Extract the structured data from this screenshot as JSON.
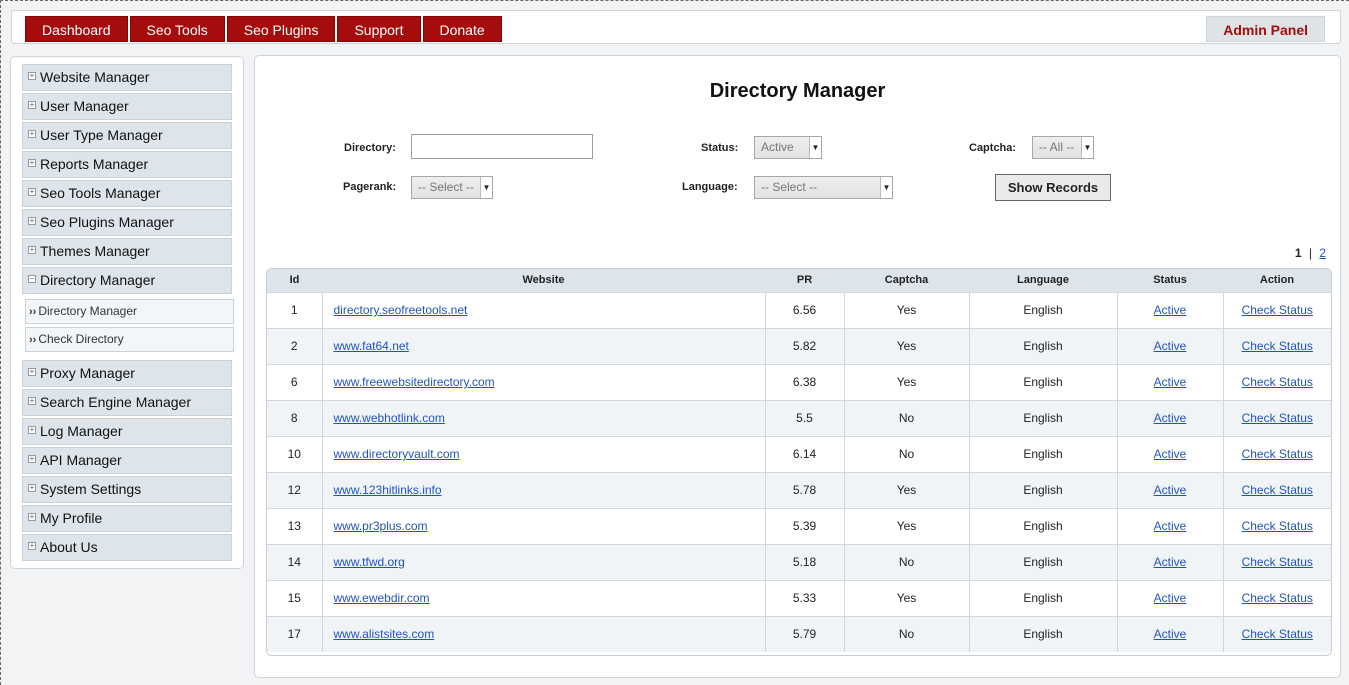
{
  "topnav": [
    "Dashboard",
    "Seo Tools",
    "Seo Plugins",
    "Support",
    "Donate"
  ],
  "admin_label": "Admin Panel",
  "sidebar": {
    "items_top": [
      "Website Manager",
      "User Manager",
      "User Type Manager",
      "Reports Manager",
      "Seo Tools Manager",
      "Seo Plugins Manager",
      "Themes Manager",
      "Directory Manager"
    ],
    "sub_items": [
      "Directory Manager",
      "Check Directory"
    ],
    "items_bottom": [
      "Proxy Manager",
      "Search Engine Manager",
      "Log Manager",
      "API Manager",
      "System Settings",
      "My Profile",
      "About Us"
    ]
  },
  "main": {
    "title": "Directory Manager",
    "filters": {
      "directory_label": "Directory:",
      "directory_value": "",
      "status_label": "Status:",
      "status_value": "Active",
      "captcha_label": "Captcha:",
      "captcha_value": "-- All --",
      "pagerank_label": "Pagerank:",
      "pagerank_value": "-- Select --",
      "language_label": "Language:",
      "language_value": "-- Select --",
      "show_button": "Show Records"
    },
    "pager": {
      "current": "1",
      "sep": "|",
      "next": "2"
    },
    "table": {
      "headers": [
        "Id",
        "Website",
        "PR",
        "Captcha",
        "Language",
        "Status",
        "Action"
      ],
      "rows": [
        {
          "id": "1",
          "website": "directory.seofreetools.net",
          "pr": "6.56",
          "captcha": "Yes",
          "language": "English",
          "status": "Active",
          "action": "Check Status"
        },
        {
          "id": "2",
          "website": "www.fat64.net",
          "pr": "5.82",
          "captcha": "Yes",
          "language": "English",
          "status": "Active",
          "action": "Check Status"
        },
        {
          "id": "6",
          "website": "www.freewebsitedirectory.com",
          "pr": "6.38",
          "captcha": "Yes",
          "language": "English",
          "status": "Active",
          "action": "Check Status"
        },
        {
          "id": "8",
          "website": "www.webhotlink.com",
          "pr": "5.5",
          "captcha": "No",
          "language": "English",
          "status": "Active",
          "action": "Check Status"
        },
        {
          "id": "10",
          "website": "www.directoryvault.com",
          "pr": "6.14",
          "captcha": "No",
          "language": "English",
          "status": "Active",
          "action": "Check Status"
        },
        {
          "id": "12",
          "website": "www.123hitlinks.info",
          "pr": "5.78",
          "captcha": "Yes",
          "language": "English",
          "status": "Active",
          "action": "Check Status"
        },
        {
          "id": "13",
          "website": "www.pr3plus.com",
          "pr": "5.39",
          "captcha": "Yes",
          "language": "English",
          "status": "Active",
          "action": "Check Status"
        },
        {
          "id": "14",
          "website": "www.tfwd.org",
          "pr": "5.18",
          "captcha": "No",
          "language": "English",
          "status": "Active",
          "action": "Check Status"
        },
        {
          "id": "15",
          "website": "www.ewebdir.com",
          "pr": "5.33",
          "captcha": "Yes",
          "language": "English",
          "status": "Active",
          "action": "Check Status"
        },
        {
          "id": "17",
          "website": "www.alistsites.com",
          "pr": "5.79",
          "captcha": "No",
          "language": "English",
          "status": "Active",
          "action": "Check Status"
        }
      ]
    }
  },
  "colors": {
    "nav_bg": "#a50d0d",
    "admin_text": "#a50d0d",
    "link": "#1f55b8",
    "header_bg": "#dde4ea"
  }
}
